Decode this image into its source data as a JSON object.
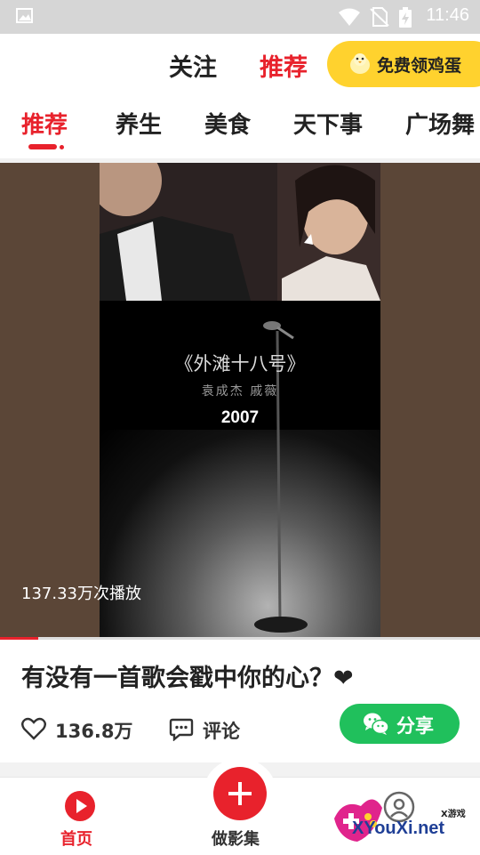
{
  "status_bar": {
    "time": "11:46"
  },
  "header": {
    "tab_follow": "关注",
    "tab_recommend": "推荐",
    "egg_button": "免费领鸡蛋"
  },
  "categories": [
    "推荐",
    "养生",
    "美食",
    "天下事",
    "广场舞"
  ],
  "video": {
    "song_title": "《外滩十八号》",
    "song_artists": "袁成杰 戚薇",
    "song_year": "2007",
    "play_count": "137.33万次播放",
    "progress": 0.08
  },
  "post": {
    "title": "有没有一首歌会戳中你的心？❤",
    "likes": "136.8万",
    "comment_label": "评论",
    "share_label": "分享"
  },
  "bottom_nav": {
    "home_label": "首页",
    "create_label": "做影集"
  },
  "watermark": {
    "text": "XYouXi.net",
    "small": "X游戏"
  },
  "colors": {
    "accent": "#e8222c",
    "egg": "#ffd22e",
    "share": "#20c05c"
  }
}
